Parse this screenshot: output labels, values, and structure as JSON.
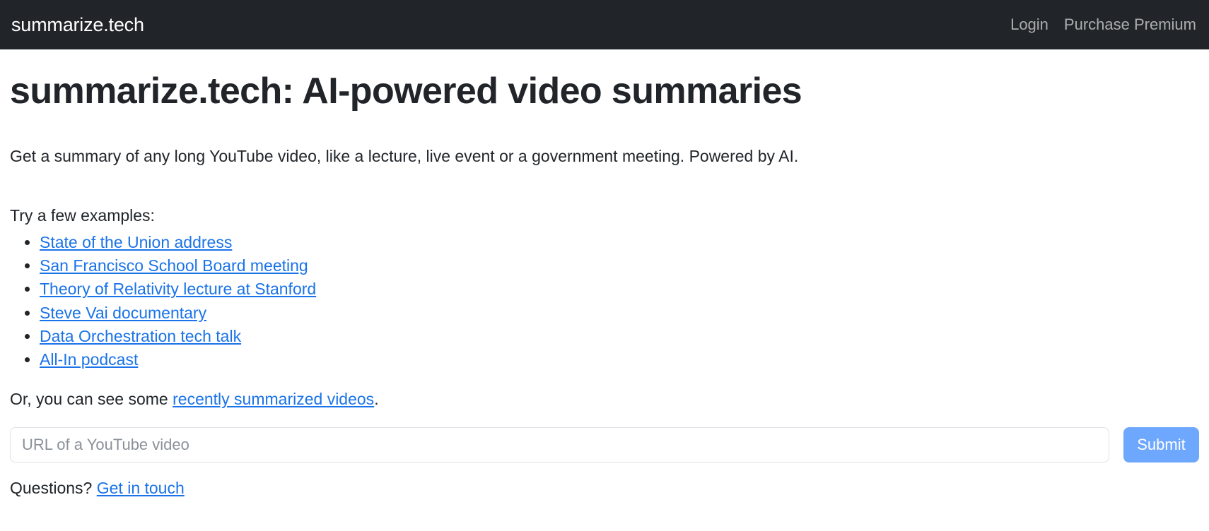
{
  "navbar": {
    "brand": "summarize.tech",
    "links": [
      {
        "label": "Login"
      },
      {
        "label": "Purchase Premium"
      }
    ]
  },
  "main": {
    "title": "summarize.tech: AI-powered video summaries",
    "lede": "Get a summary of any long YouTube video, like a lecture, live event or a government meeting. Powered by AI.",
    "examples_intro": "Try a few examples:",
    "examples": [
      {
        "label": "State of the Union address"
      },
      {
        "label": "San Francisco School Board meeting"
      },
      {
        "label": "Theory of Relativity lecture at Stanford"
      },
      {
        "label": "Steve Vai documentary"
      },
      {
        "label": "Data Orchestration tech talk"
      },
      {
        "label": "All-In podcast"
      }
    ],
    "recent": {
      "prefix": "Or, you can see some ",
      "link": "recently summarized videos",
      "suffix": "."
    },
    "form": {
      "placeholder": "URL of a YouTube video",
      "value": "",
      "submit_label": "Submit"
    },
    "questions": {
      "prefix": "Questions? ",
      "link": "Get in touch"
    }
  },
  "colors": {
    "navbar_bg": "#212529",
    "link": "#1a73e8",
    "submit_bg": "#6ea8fe",
    "text": "#212529",
    "placeholder": "#8b9199"
  }
}
